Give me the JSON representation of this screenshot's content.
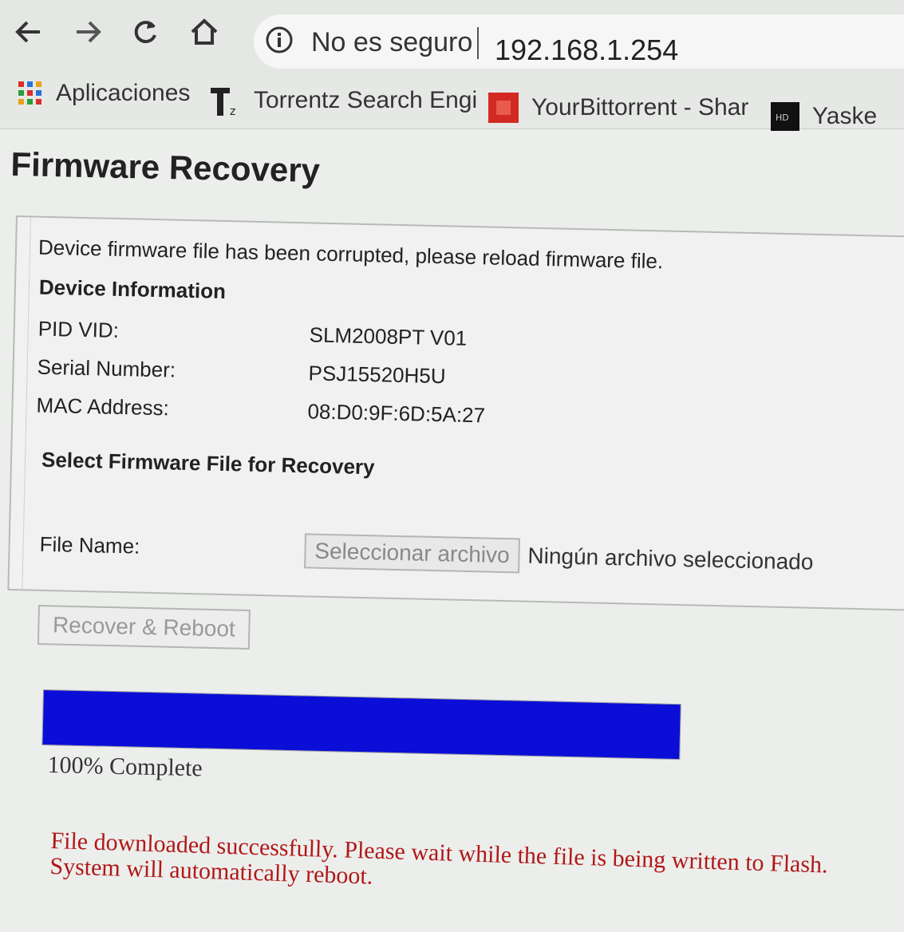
{
  "browser": {
    "security_text": "No es seguro",
    "url": "192.168.1.254",
    "bookmarks": [
      {
        "label": "Aplicaciones",
        "icon": "apps-grid-icon"
      },
      {
        "label": "Torrentz Search Engi",
        "icon": "torrentz-icon"
      },
      {
        "label": "YourBittorrent - Shar",
        "icon": "yourbittorrent-icon"
      },
      {
        "label": "Yaske",
        "icon": "hd-icon"
      }
    ]
  },
  "page": {
    "title": "Firmware Recovery",
    "message": "Device firmware file has been corrupted, please reload firmware file.",
    "device_info_heading": "Device Information",
    "device_info": [
      {
        "label": "PID VID:",
        "value": "SLM2008PT V01"
      },
      {
        "label": "Serial Number:",
        "value": "PSJ15520H5U"
      },
      {
        "label": "MAC Address:",
        "value": "08:D0:9F:6D:5A:27"
      }
    ],
    "select_heading": "Select Firmware File for Recovery",
    "file_name_label": "File Name:",
    "file_button_label": "Seleccionar archivo",
    "file_status": "Ningún archivo seleccionado",
    "recover_button_label": "Recover & Reboot",
    "progress_percent": 100,
    "progress_text": "100% Complete",
    "success_line1": "File downloaded successfully. Please wait while the file is being written to Flash.",
    "success_line2": "System will automatically reboot."
  },
  "colors": {
    "progress_fill": "#0a0ed6",
    "success_text": "#b01818"
  }
}
